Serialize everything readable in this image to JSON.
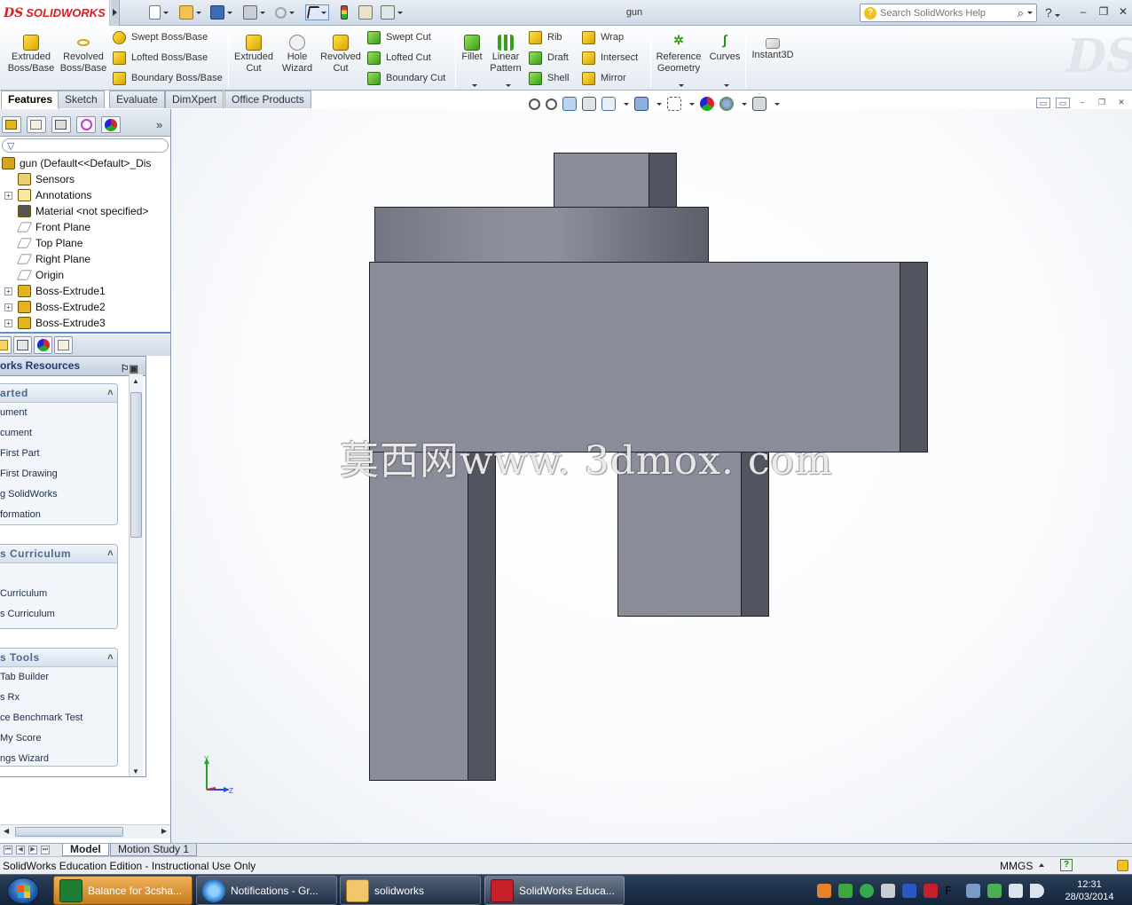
{
  "app": {
    "brand": "SOLIDWORKS",
    "doc_title": "gun",
    "search_placeholder": "Search SolidWorks Help"
  },
  "command_manager": {
    "big_buttons": [
      {
        "line1": "Extruded",
        "line2": "Boss/Base"
      },
      {
        "line1": "Revolved",
        "line2": "Boss/Base"
      },
      {
        "line1": "Extruded",
        "line2": "Cut"
      },
      {
        "line1": "Hole",
        "line2": "Wizard"
      },
      {
        "line1": "Revolved",
        "line2": "Cut"
      },
      {
        "line1": "Fillet",
        "line2": ""
      },
      {
        "line1": "Linear",
        "line2": "Pattern"
      },
      {
        "line1": "Reference",
        "line2": "Geometry"
      },
      {
        "line1": "Curves",
        "line2": ""
      },
      {
        "line1": "Instant3D",
        "line2": ""
      }
    ],
    "small_buttons": {
      "swept_boss": "Swept Boss/Base",
      "lofted_boss": "Lofted Boss/Base",
      "boundary_boss": "Boundary Boss/Base",
      "swept_cut": "Swept Cut",
      "lofted_cut": "Lofted Cut",
      "boundary_cut": "Boundary Cut",
      "rib": "Rib",
      "draft": "Draft",
      "shell": "Shell",
      "wrap": "Wrap",
      "intersect": "Intersect",
      "mirror": "Mirror"
    }
  },
  "tabs": [
    "Features",
    "Sketch",
    "Evaluate",
    "DimXpert",
    "Office Products"
  ],
  "feature_tree": [
    {
      "label": "gun  (Default<<Default>_Dis",
      "expand": ""
    },
    {
      "label": "Sensors",
      "expand": ""
    },
    {
      "label": "Annotations",
      "expand": "+"
    },
    {
      "label": "Material <not specified>",
      "expand": ""
    },
    {
      "label": "Front Plane",
      "expand": ""
    },
    {
      "label": "Top Plane",
      "expand": ""
    },
    {
      "label": "Right Plane",
      "expand": ""
    },
    {
      "label": "Origin",
      "expand": ""
    },
    {
      "label": "Boss-Extrude1",
      "expand": "+"
    },
    {
      "label": "Boss-Extrude2",
      "expand": "+"
    },
    {
      "label": "Boss-Extrude3",
      "expand": "+"
    }
  ],
  "task_pane": {
    "header": "orks Resources",
    "sections": [
      {
        "title": "arted",
        "links": [
          "ument",
          "cument",
          "First Part",
          "First Drawing",
          "g SolidWorks",
          "formation"
        ]
      },
      {
        "title": "s Curriculum",
        "links": [
          "",
          "Curriculum",
          "s Curriculum"
        ]
      },
      {
        "title": "s Tools",
        "links": [
          "Tab Builder",
          "s Rx",
          "ce Benchmark Test",
          "My Score",
          "ngs Wizard"
        ]
      }
    ]
  },
  "watermark": "莫西网www. 3dmox. com",
  "triad": {
    "y": "Y",
    "z": "Z"
  },
  "bottom_tabs": [
    "Model",
    "Motion Study 1"
  ],
  "status": {
    "text": "SolidWorks Education Edition - Instructional Use Only",
    "units": "MMGS"
  },
  "taskbar": {
    "items": [
      "Balance for 3csha...",
      "Notifications - Gr...",
      "solidworks",
      "SolidWorks Educa..."
    ],
    "time": "12:31",
    "date": "28/03/2014"
  },
  "colors": {
    "model_front": "#8a8c9a",
    "model_side": "#52545f",
    "brand_red": "#d51f26",
    "tree_divider": "#5c8fd0"
  }
}
